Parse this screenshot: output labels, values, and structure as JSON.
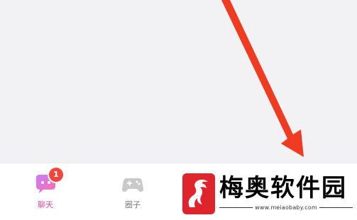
{
  "tabs": [
    {
      "label": "聊天",
      "badge": "1",
      "icon": "chat-bubble-icon",
      "color": "#d84f9a"
    },
    {
      "label": "圈子",
      "icon": "gamepad-icon",
      "color": "#7a7a7a"
    }
  ],
  "watermark": {
    "brand": "梅奥软件园",
    "url": "www.meiaobaby.com",
    "logo": "dragon-logo"
  },
  "annotation": {
    "arrow_color": "#ee3b22",
    "icon": "red-arrow-icon"
  }
}
